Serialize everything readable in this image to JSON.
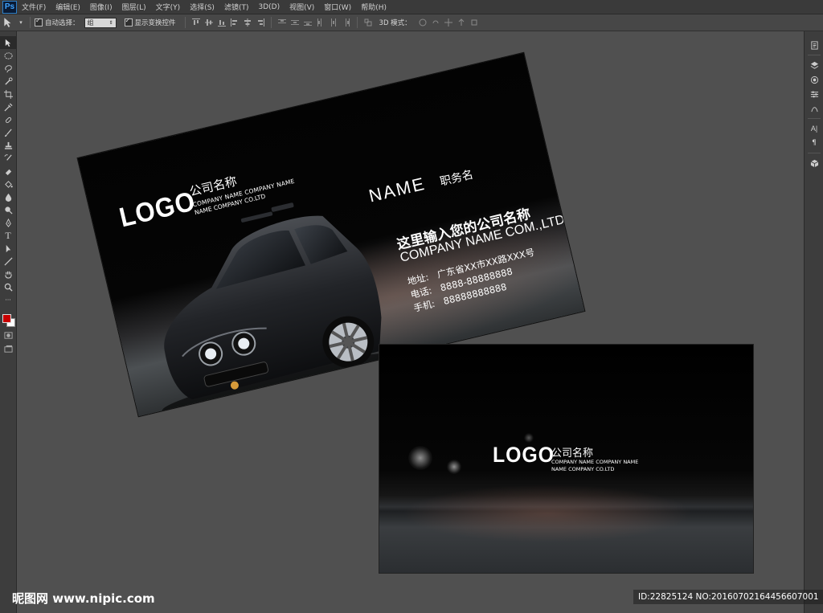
{
  "app": {
    "logo": "Ps",
    "menu": [
      "文件(F)",
      "编辑(E)",
      "图像(I)",
      "图层(L)",
      "文字(Y)",
      "选择(S)",
      "滤镜(T)",
      "3D(D)",
      "视图(V)",
      "窗口(W)",
      "帮助(H)"
    ]
  },
  "options": {
    "auto_select_label": "自动选择：",
    "auto_select_value": "组",
    "show_transform_label": "显示变换控件",
    "mode_3d_label": "3D 模式："
  },
  "card_front": {
    "logo": "LOGO",
    "company_cn": "公司名称",
    "company_sub1": "COMPANY NAME COMPANY NAME",
    "company_sub2": "NAME COMPANY CO.LTD",
    "name": "NAME",
    "job_title": "职务名",
    "headline_cn": "这里输入您的公司名称",
    "headline_en": "COMPANY NAME COM.,LTD",
    "address_label": "地址:",
    "address_value": "广东省XX市XX路XXX号",
    "phone_label": "电话:",
    "phone_value": "8888-88888888",
    "mobile_label": "手机:",
    "mobile_value": "88888888888"
  },
  "card_back": {
    "logo": "LOGO",
    "company_cn": "公司名称",
    "company_sub1": "COMPANY NAME COMPANY NAME",
    "company_sub2": "NAME COMPANY CO.LTD"
  },
  "watermark": {
    "site": "昵图网 www.nipic.com",
    "id_text": "ID:22825124 NO:20160702164456607001"
  },
  "colors": {
    "foreground_swatch": "#c80000",
    "background_swatch": "#ffffff",
    "workspace": "#505050"
  }
}
